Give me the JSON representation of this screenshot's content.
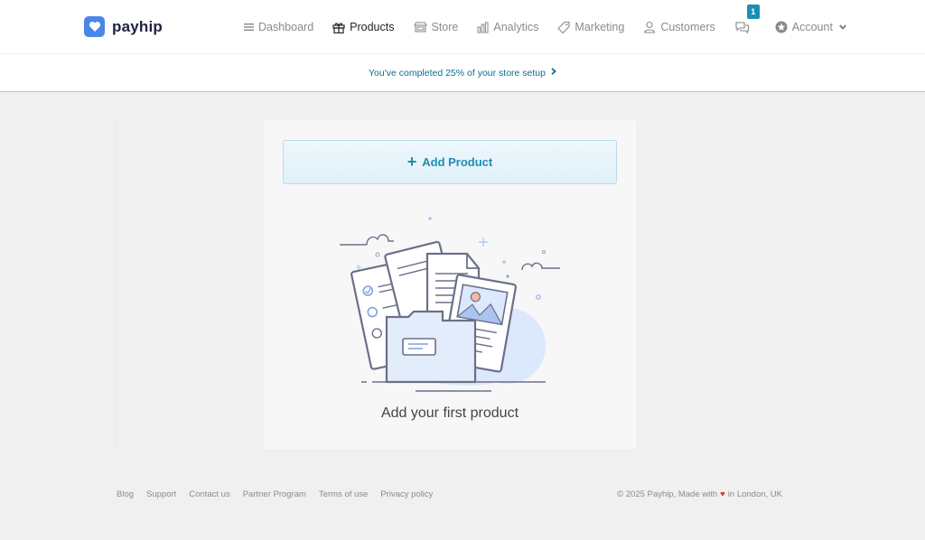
{
  "brand": {
    "name": "payhip",
    "accent": "#1a8fb4",
    "logo_color": "#4a86e8"
  },
  "nav": {
    "items": [
      {
        "label": "Dashboard",
        "icon": "menu-icon",
        "active": false
      },
      {
        "label": "Products",
        "icon": "gift-icon",
        "active": true
      },
      {
        "label": "Store",
        "icon": "store-icon",
        "active": false
      },
      {
        "label": "Analytics",
        "icon": "analytics-icon",
        "active": false
      },
      {
        "label": "Marketing",
        "icon": "tag-icon",
        "active": false
      },
      {
        "label": "Customers",
        "icon": "user-icon",
        "active": false
      }
    ],
    "chat_badge": "1",
    "account_label": "Account"
  },
  "setup_banner": {
    "text": "You've completed 25% of your store setup",
    "progress_percent": 25,
    "arrow": "›"
  },
  "main": {
    "add_button_icon": "+",
    "add_button_label": "Add Product",
    "empty_title": "Add your first product"
  },
  "footer": {
    "links": [
      "Blog",
      "Support",
      "Contact us",
      "Partner Program",
      "Terms of use",
      "Privacy policy"
    ],
    "copyright_prefix": "© 2025 Payhip, Made with",
    "heart": "♥",
    "copyright_suffix": "in London, UK"
  }
}
